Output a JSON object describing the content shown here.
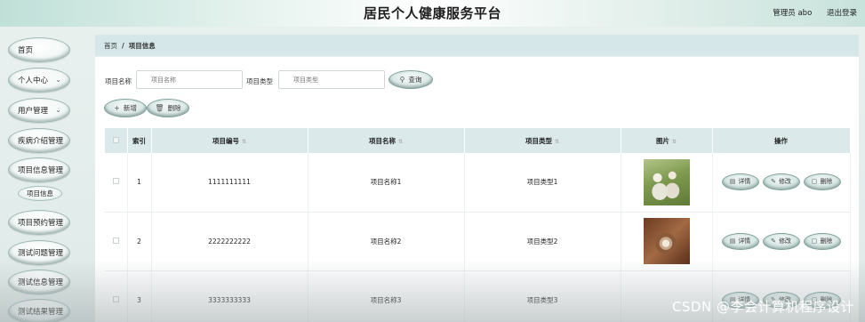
{
  "header": {
    "title": "居民个人健康服务平台",
    "user_label": "管理员 abo",
    "logout_label": "退出登录"
  },
  "sidebar": {
    "items": [
      {
        "label": "首页",
        "has_chevron": false
      },
      {
        "label": "个人中心",
        "has_chevron": true
      },
      {
        "label": "用户管理",
        "has_chevron": true
      },
      {
        "label": "疾病介绍管理",
        "has_chevron": false
      },
      {
        "label": "项目信息管理",
        "has_chevron": false
      },
      {
        "label": "项目预约管理",
        "has_chevron": false
      },
      {
        "label": "测试问题管理",
        "has_chevron": false
      },
      {
        "label": "测试信息管理",
        "has_chevron": false
      },
      {
        "label": "测试结果管理",
        "has_chevron": false
      }
    ],
    "subitem": {
      "label": "项目信息"
    }
  },
  "breadcrumb": {
    "home": "首页",
    "separator": "/",
    "current": "项目信息"
  },
  "search": {
    "name_label": "项目名称",
    "name_placeholder": "项目名称",
    "type_label": "项目类型",
    "type_placeholder": "项目类型",
    "query_button": "查询"
  },
  "actions": {
    "add_button": "新增",
    "delete_button": "删除"
  },
  "table": {
    "columns": [
      "索引",
      "项目编号",
      "项目名称",
      "项目类型",
      "图片",
      "操作"
    ],
    "rows": [
      {
        "index": "1",
        "code": "1111111111",
        "name": "项目名称1",
        "type": "项目类型1"
      },
      {
        "index": "2",
        "code": "2222222222",
        "name": "项目名称2",
        "type": "项目类型2"
      },
      {
        "index": "3",
        "code": "3333333333",
        "name": "项目名称3",
        "type": "项目类型3"
      }
    ],
    "row_buttons": {
      "detail": "详情",
      "edit": "修改",
      "delete": "删除"
    }
  },
  "watermark": "CSDN @李会计算机程序设计"
}
